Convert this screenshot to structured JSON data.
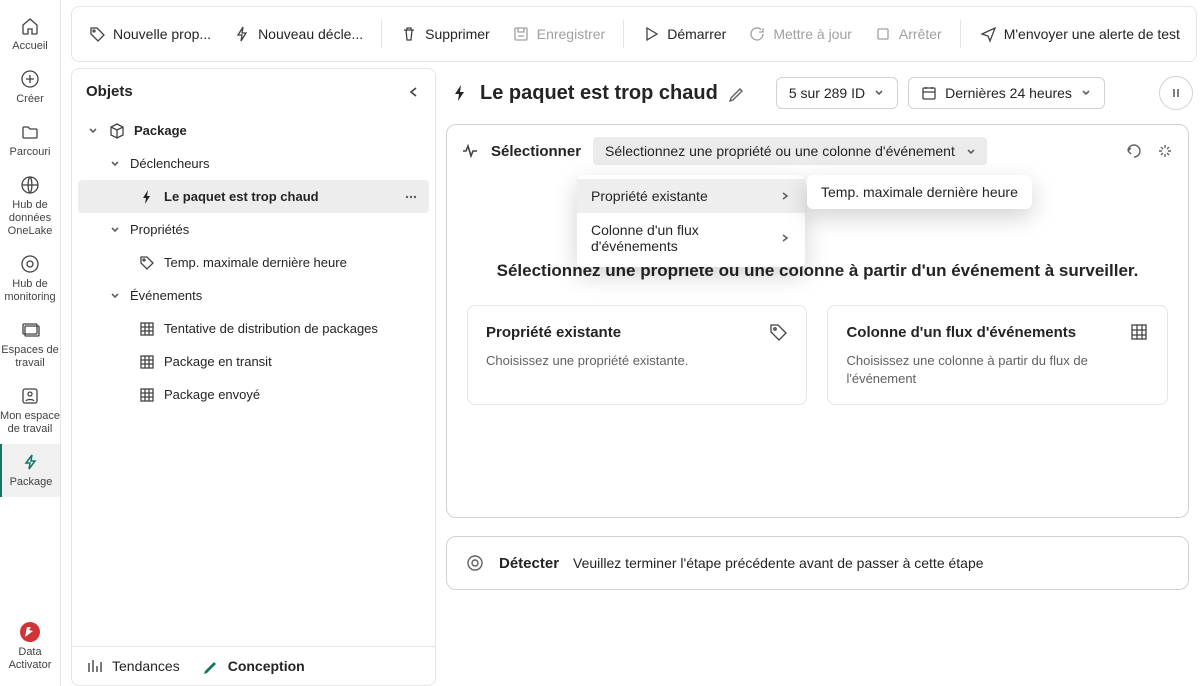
{
  "vnav": {
    "home": "Accueil",
    "create": "Créer",
    "browse": "Parcouri",
    "datahub": "Hub de données OneLake",
    "monitor": "Hub de monitoring",
    "workspaces": "Espaces de travail",
    "myworkspace": "Mon espace de travail",
    "package": "Package",
    "data_activator": "Data Activator"
  },
  "toolbar": {
    "new_prop": "Nouvelle prop...",
    "new_trigger": "Nouveau décle...",
    "delete": "Supprimer",
    "save": "Enregistrer",
    "start": "Démarrer",
    "update": "Mettre à jour",
    "stop": "Arrêter",
    "send_alert": "M'envoyer une alerte de test"
  },
  "objects": {
    "title": "Objets",
    "package": "Package",
    "triggers_section": "Déclencheurs",
    "trigger1": "Le paquet est trop chaud",
    "properties_section": "Propriétés",
    "prop1": "Temp. maximale dernière heure",
    "events_section": "Événements",
    "event1": "Tentative de distribution de packages",
    "event2": "Package en transit",
    "event3": "Package envoyé",
    "tab_trends": "Tendances",
    "tab_design": "Conception"
  },
  "detail": {
    "title": "Le paquet est trop chaud",
    "id_pill": "5 sur 289 ID",
    "time_pill": "Dernières 24 heures",
    "select_label": "Sélectionner",
    "select_placeholder": "Sélectionnez une propriété ou une colonne d'événement",
    "dd_existing": "Propriété existante",
    "dd_eventcol": "Colonne d'un flux d'événements",
    "flyout_item": "Temp. maximale dernière heure",
    "instruction": "Sélectionnez une propriété ou une colonne à partir d'un événement à surveiller.",
    "card1_title": "Propriété existante",
    "card1_desc": "Choisissez une propriété existante.",
    "card2_title": "Colonne d'un flux d'événements",
    "card2_desc": "Choisissez une colonne à partir du flux de l'événement",
    "detect_label": "Détecter",
    "detect_msg": "Veuillez terminer l'étape précédente avant de passer à cette étape"
  }
}
